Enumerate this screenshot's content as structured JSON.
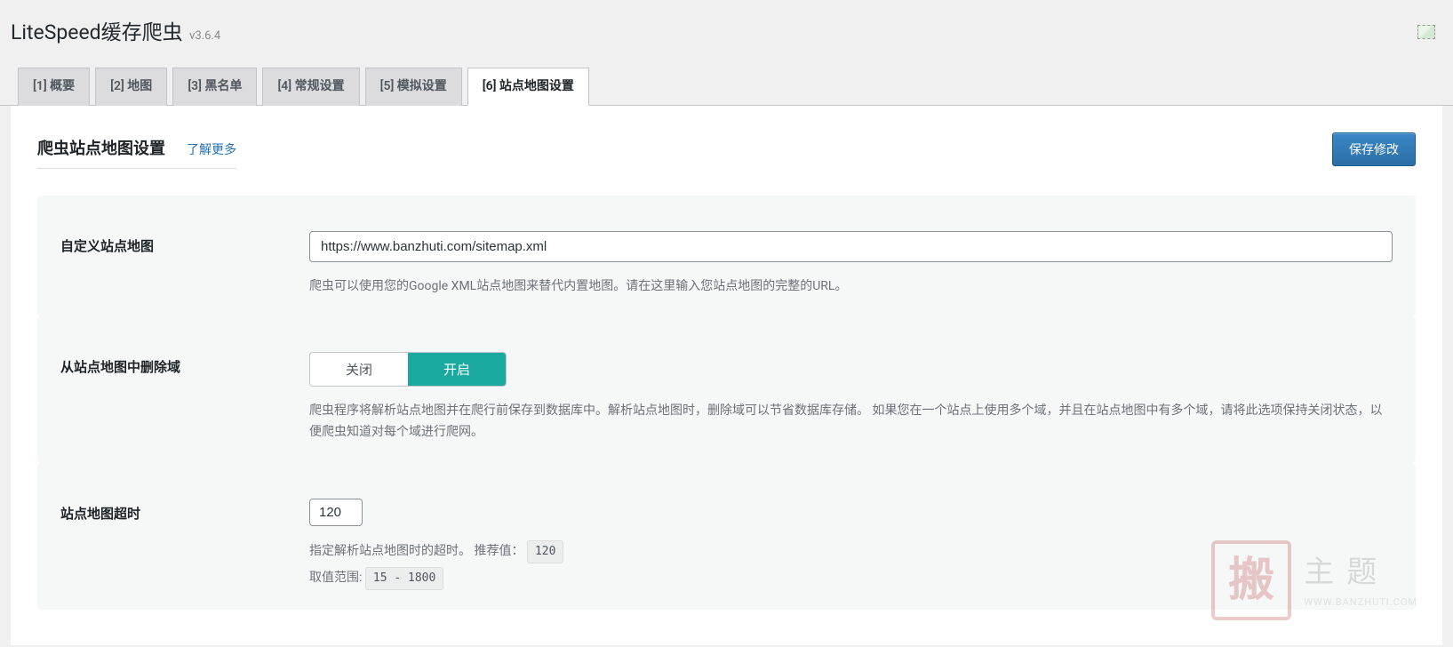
{
  "header": {
    "title": "LiteSpeed缓存爬虫",
    "version": "v3.6.4"
  },
  "tabs": [
    {
      "label": "[1] 概要"
    },
    {
      "label": "[2] 地图"
    },
    {
      "label": "[3] 黑名单"
    },
    {
      "label": "[4] 常规设置"
    },
    {
      "label": "[5] 模拟设置"
    },
    {
      "label": "[6] 站点地图设置"
    }
  ],
  "section": {
    "title": "爬虫站点地图设置",
    "learn_more": "了解更多",
    "save_label": "保存修改"
  },
  "settings": {
    "custom_sitemap": {
      "label": "自定义站点地图",
      "value": "https://www.banzhuti.com/sitemap.xml",
      "helper": "爬虫可以使用您的Google XML站点地图来替代内置地图。请在这里输入您站点地图的完整的URL。"
    },
    "drop_domain": {
      "label": "从站点地图中删除域",
      "off_label": "关闭",
      "on_label": "开启",
      "helper": "爬虫程序将解析站点地图并在爬行前保存到数据库中。解析站点地图时，删除域可以节省数据库存储。 如果您在一个站点上使用多个域，并且在站点地图中有多个域，请将此选项保持关闭状态，以便爬虫知道对每个域进行爬网。"
    },
    "sitemap_timeout": {
      "label": "站点地图超时",
      "value": "120",
      "helper_prefix": "指定解析站点地图时的超时。 推荐值：",
      "recommended": "120",
      "range_prefix": "取值范围:",
      "range": "15 - 1800"
    }
  },
  "watermark": {
    "seal": "搬",
    "text": "主题",
    "sub": "WWW.BANZHUTI.COM"
  }
}
